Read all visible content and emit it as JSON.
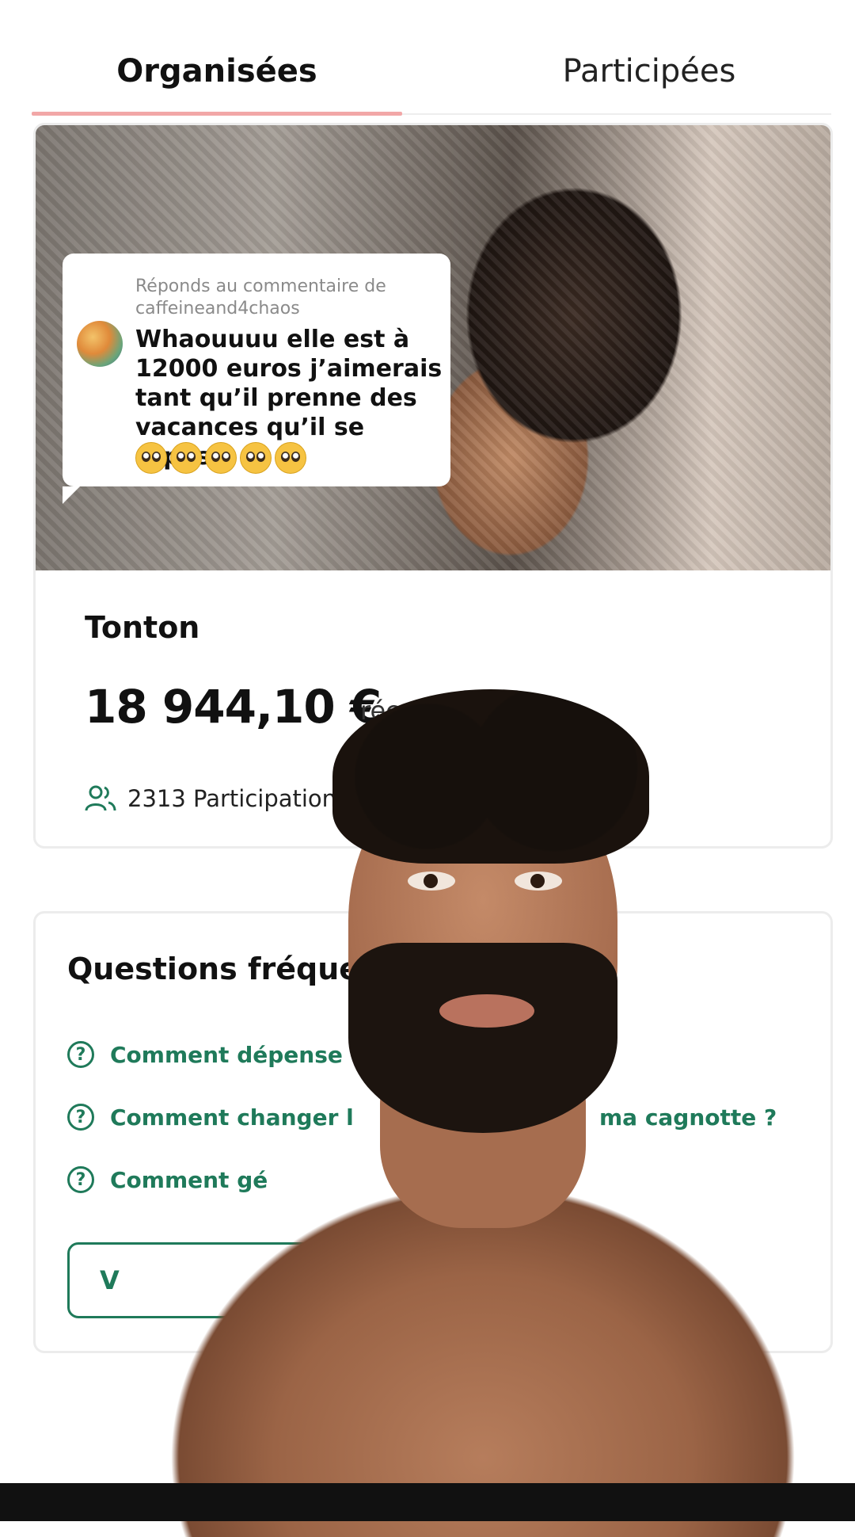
{
  "tabs": {
    "organised": "Organisées",
    "participated": "Participées"
  },
  "comment": {
    "reply_to": "Réponds au commentaire de caffeineand4chaos",
    "text": "Whaouuuu elle est à 12000 euros j’aimerais tant qu’il prenne des vacances qu’il se repose",
    "emoji_count": 5,
    "emoji": "pleading-face"
  },
  "campaign": {
    "title": "Tonton",
    "amount": "18 944,10 €",
    "amount_suffix": "réc",
    "participations": "2313 Participations"
  },
  "faq": {
    "title": "Questions fréquen",
    "items": [
      "Comment dépense",
      "Comment changer l",
      "Comment gé"
    ],
    "item_tail": "ma cagnotte ?",
    "button_label": "V"
  },
  "colors": {
    "accent_green": "#1f7a5a",
    "tab_underline": "#f2a7a7"
  },
  "icons": [
    "users-icon",
    "question-icon"
  ]
}
